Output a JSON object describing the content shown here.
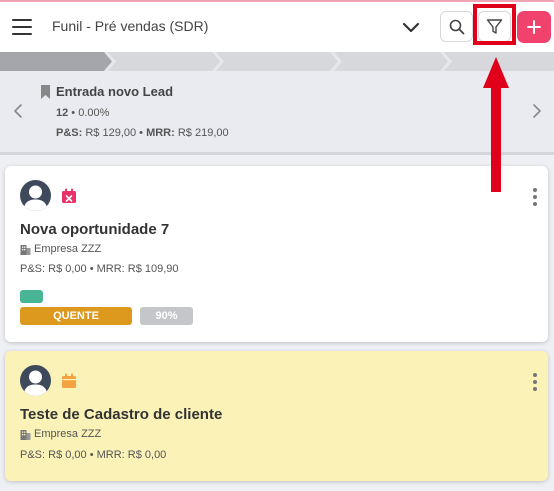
{
  "header": {
    "funnel_title": "Funil - Pré vendas (SDR)"
  },
  "stage": {
    "name": "Entrada novo Lead",
    "count": "12",
    "percent": "0.00%",
    "ps_label": "P&S:",
    "ps_value": "R$ 129,00",
    "mrr_label": "MRR:",
    "mrr_value": "R$ 219,00"
  },
  "cards": [
    {
      "title": "Nova oportunidade 7",
      "company": "Empresa ZZZ",
      "values": "P&S: R$ 0,00 • MRR: R$ 109,90",
      "temperature": "QUENTE",
      "probability": "90%"
    },
    {
      "title": "Teste de Cadastro de cliente",
      "company": "Empresa ZZZ",
      "values": "P&S: R$ 0,00 • MRR: R$ 0,00"
    }
  ],
  "colors": {
    "accent": "#f0426d",
    "highlight": "#e0001a",
    "hot": "#dd981e",
    "tag": "#47b596",
    "card_yellow": "#fbf2b8"
  }
}
